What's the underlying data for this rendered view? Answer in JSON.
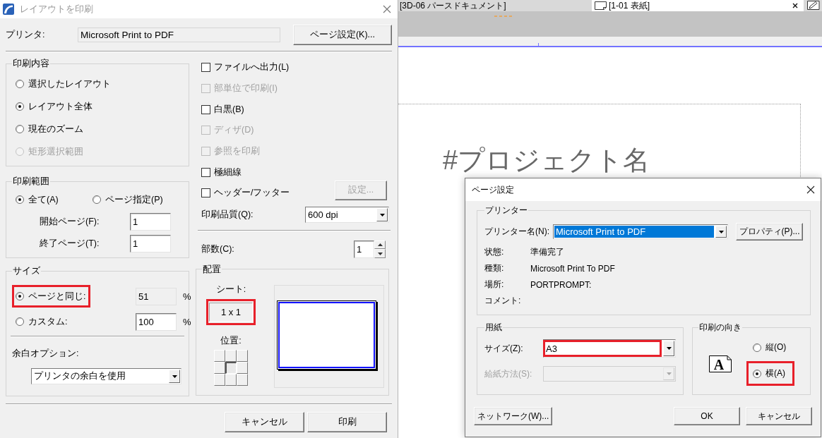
{
  "print_dialog": {
    "title": "レイアウトを印刷",
    "active": false,
    "printer_label": "プリンタ:",
    "printer_value": "Microsoft Print to PDF",
    "page_setup_button": "ページ設定(K)...",
    "print_content": {
      "title": "印刷内容",
      "options": [
        {
          "label": "選択したレイアウト",
          "selected": false,
          "disabled": false
        },
        {
          "label": "レイアウト全体",
          "selected": true,
          "disabled": false
        },
        {
          "label": "現在のズーム",
          "selected": false,
          "disabled": false
        },
        {
          "label": "矩形選択範囲",
          "selected": false,
          "disabled": true
        }
      ]
    },
    "print_range": {
      "title": "印刷範囲",
      "options": [
        {
          "label": "全て(A)",
          "selected": true
        },
        {
          "label": "ページ指定(P)",
          "selected": false
        }
      ],
      "fields": [
        {
          "label": "開始ページ(F):",
          "value": "1"
        },
        {
          "label": "終了ページ(T):",
          "value": "1"
        }
      ]
    },
    "size": {
      "title": "サイズ",
      "options": [
        {
          "label": "ページと同じ:",
          "selected": true,
          "highlighted": true,
          "value": "51",
          "unit": "%",
          "readonly": true
        },
        {
          "label": "カスタム:",
          "selected": false,
          "highlighted": false,
          "value": "100",
          "unit": "%",
          "readonly": false
        }
      ],
      "margin_label": "余白オプション:",
      "margin_value": "プリンタの余白を使用"
    },
    "options": [
      {
        "label": "ファイルへ出力(L)",
        "checked": false,
        "disabled": false
      },
      {
        "label": "部単位で印刷(I)",
        "checked": false,
        "disabled": true
      },
      {
        "label": "白黒(B)",
        "checked": false,
        "disabled": false
      },
      {
        "label": "ディザ(D)",
        "checked": false,
        "disabled": true
      },
      {
        "label": "参照を印刷",
        "checked": false,
        "disabled": true
      },
      {
        "label": "極細線",
        "checked": false,
        "disabled": false
      },
      {
        "label": "ヘッダー/フッター",
        "checked": false,
        "disabled": false
      }
    ],
    "header_footer_button": {
      "label": "設定...",
      "disabled": true
    },
    "quality_label": "印刷品質(Q):",
    "quality_value": "600 dpi",
    "copies_label": "部数(C):",
    "copies_value": "1",
    "placement": {
      "title": "配置",
      "sheet_label": "シート:",
      "sheet_value": "1 x 1",
      "sheet_highlighted": true,
      "position_label": "位置:",
      "positions": [
        {
          "selected": false
        },
        {
          "selected": false
        },
        {
          "selected": false
        },
        {
          "selected": false
        },
        {
          "selected": true
        },
        {
          "selected": false
        },
        {
          "selected": false
        },
        {
          "selected": false
        },
        {
          "selected": false
        }
      ]
    },
    "buttons": [
      "キャンセル",
      "印刷"
    ]
  },
  "document_window": {
    "tabs": [
      {
        "label": "[3D-06 パースドキュメント]",
        "selected": false
      },
      {
        "label": "[1-01 表紙]",
        "selected": true
      }
    ],
    "canvas_title": "#プロジェクト名"
  },
  "page_setup_dialog": {
    "title": "ページ設定",
    "active": true,
    "printer_group": {
      "title": "プリンター",
      "name_label": "プリンター名(N):",
      "name_value": "Microsoft Print to PDF",
      "name_focused": true,
      "properties_button": "プロパティ(P)...",
      "info": [
        {
          "label": "状態:",
          "value": "準備完了"
        },
        {
          "label": "種類:",
          "value": "Microsoft Print To PDF"
        },
        {
          "label": "場所:",
          "value": "PORTPROMPT:"
        },
        {
          "label": "コメント:"
        }
      ]
    },
    "paper_group": {
      "title": "用紙",
      "fields": [
        {
          "label": "サイズ(Z):",
          "value": "A3",
          "disabled": false,
          "highlighted": true
        },
        {
          "label": "給紙方法(S):",
          "disabled": true,
          "highlighted": false
        }
      ]
    },
    "orientation_group": {
      "title": "印刷の向き",
      "icon_letter": "A",
      "options": [
        {
          "label": "縦(O)",
          "selected": false,
          "highlighted": false
        },
        {
          "label": "横(A)",
          "selected": true,
          "highlighted": true
        }
      ]
    },
    "buttons": [
      "ネットワーク(W)...",
      "OK",
      "キャンセル"
    ]
  }
}
